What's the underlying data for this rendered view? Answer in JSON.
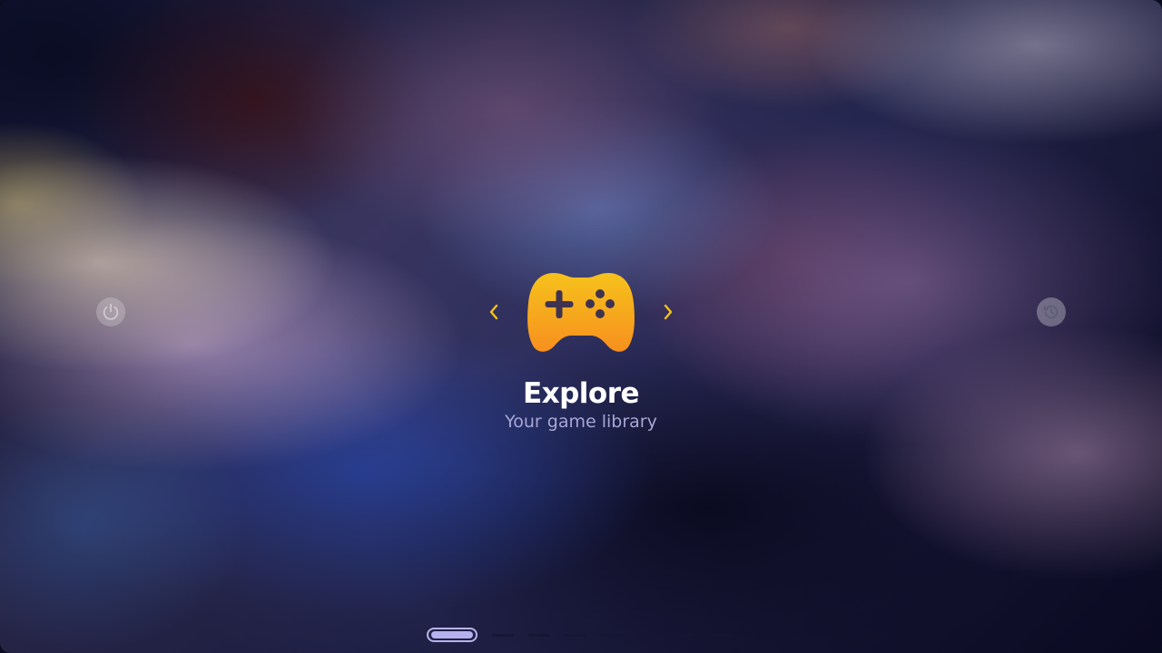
{
  "menu": {
    "title": "Explore",
    "subtitle": "Your game library",
    "icon": "gamepad-icon",
    "accent_gradient": [
      "#f6c21c",
      "#f7901e"
    ],
    "arrow_color": "#f2c318"
  },
  "controls": {
    "left_button_icon": "power-icon",
    "right_button_icon": "history-icon",
    "prev_arrow_icon": "chevron-left-icon",
    "next_arrow_icon": "chevron-right-icon"
  },
  "pager": {
    "page_count": 8,
    "current_page": 1
  }
}
